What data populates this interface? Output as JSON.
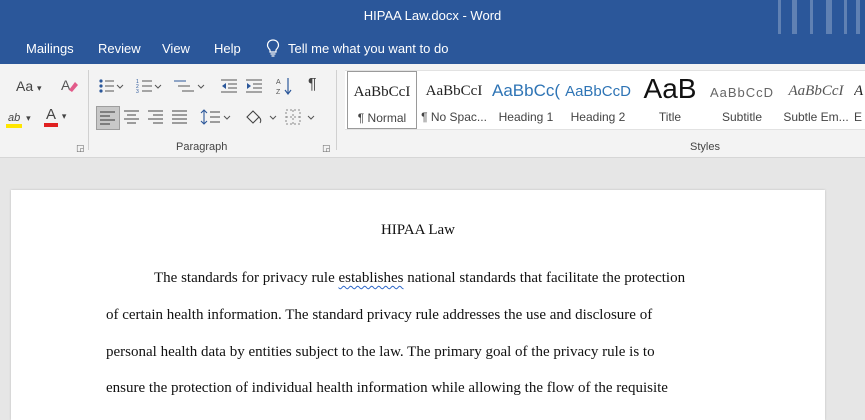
{
  "window": {
    "title": "HIPAA Law.docx  -  Word"
  },
  "tabs": [
    "Mailings",
    "Review",
    "View",
    "Help"
  ],
  "tell_me": {
    "placeholder": "Tell me what you want to do"
  },
  "ribbon": {
    "font_group": {
      "change_case": "Aa",
      "font_color_glyph": "A",
      "highlight_glyph": "ab"
    },
    "paragraph_group": {
      "label": "Paragraph",
      "show_marks_glyph": "¶"
    },
    "styles_group": {
      "label": "Styles",
      "items": [
        {
          "preview": "AaBbCcI",
          "name": "¶ Normal"
        },
        {
          "preview": "AaBbCcI",
          "name": "¶ No Spac..."
        },
        {
          "preview": "AaBbCc(",
          "name": "Heading 1"
        },
        {
          "preview": "AaBbCcD",
          "name": "Heading 2"
        },
        {
          "preview": "AaB",
          "name": "Title"
        },
        {
          "preview": "AaBbCcD",
          "name": "Subtitle"
        },
        {
          "preview": "AaBbCcI",
          "name": "Subtle Em..."
        },
        {
          "preview": "A",
          "name": "E"
        }
      ]
    }
  },
  "colors": {
    "accent": "#2b579a",
    "font_color": "#e02020",
    "highlight": "#ffe600"
  },
  "document": {
    "title": "HIPAA Law",
    "lines": [
      {
        "before": "The standards for privacy rule ",
        "flagged": "establishes",
        "after": " national standards that facilitate the protection"
      },
      {
        "before": "of certain health information. The standard privacy rule addresses the use and disclosure of",
        "flagged": "",
        "after": ""
      },
      {
        "before": "personal health data by entities subject to the law. The primary goal of the privacy rule is to",
        "flagged": "",
        "after": ""
      },
      {
        "before": "ensure the protection of individual health information while allowing the flow of the requisite",
        "flagged": "",
        "after": ""
      }
    ]
  }
}
